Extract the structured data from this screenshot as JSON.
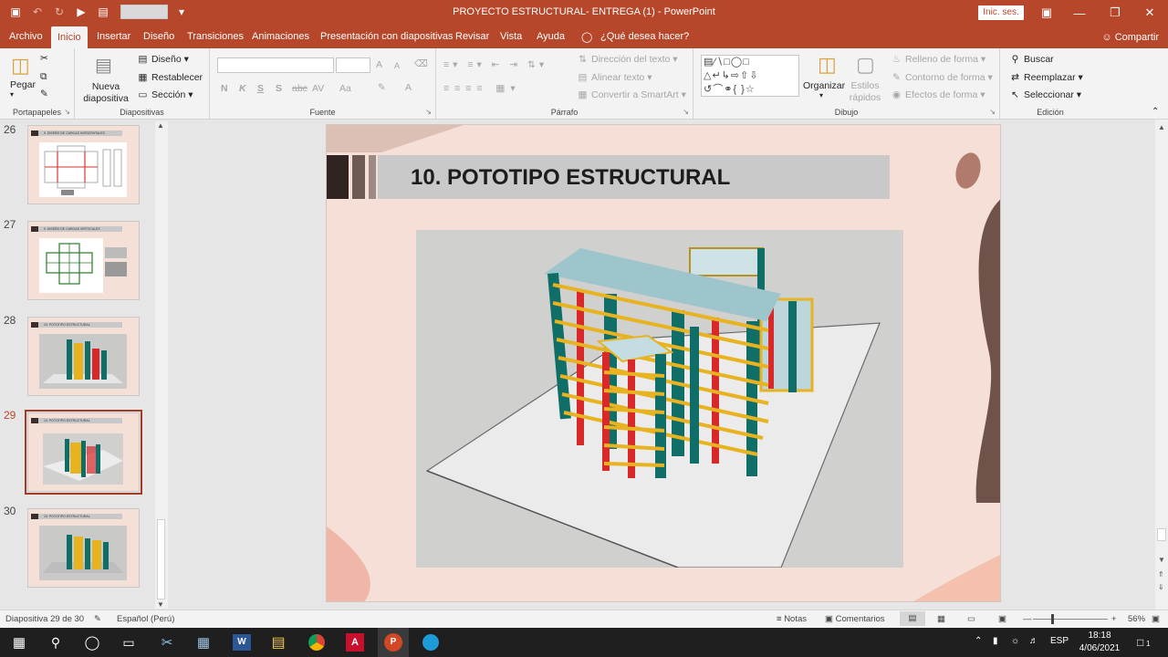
{
  "window": {
    "title": "PROYECTO ESTRUCTURAL- ENTREGA (1)  -  PowerPoint",
    "signin": "Inic. ses."
  },
  "tabs": [
    {
      "label": "Archivo"
    },
    {
      "label": "Inicio"
    },
    {
      "label": "Insertar"
    },
    {
      "label": "Diseño"
    },
    {
      "label": "Transiciones"
    },
    {
      "label": "Animaciones"
    },
    {
      "label": "Presentación con diapositivas"
    },
    {
      "label": "Revisar"
    },
    {
      "label": "Vista"
    },
    {
      "label": "Ayuda"
    }
  ],
  "tell_me": "¿Qué desea hacer?",
  "share": "Compartir",
  "ribbon": {
    "portapapeles": {
      "label": "Portapapeles",
      "paste": "Pegar"
    },
    "diapositivas": {
      "label": "Diapositivas",
      "new_slide": "Nueva diapositiva",
      "layout": "Diseño",
      "reset": "Restablecer",
      "section": "Sección"
    },
    "fuente": {
      "label": "Fuente",
      "bold": "N",
      "italic": "K",
      "underline": "S",
      "shadow": "S",
      "strike": "abc",
      "spacing": "AV",
      "case": "Aa",
      "grow": "A",
      "shrink": "A",
      "color": "A"
    },
    "parrafo": {
      "label": "Párrafo",
      "text_direction": "Dirección del texto",
      "align_text": "Alinear texto",
      "smartart": "Convertir a SmartArt"
    },
    "dibujo": {
      "label": "Dibujo",
      "arrange": "Organizar",
      "quick_styles": "Estilos rápidos",
      "fill": "Relleno de forma",
      "outline": "Contorno de forma",
      "effects": "Efectos de forma"
    },
    "edicion": {
      "label": "Edición",
      "find": "Buscar",
      "replace": "Reemplazar",
      "select": "Seleccionar"
    }
  },
  "thumbnails": [
    {
      "num": "26",
      "title": "9. DISEÑO DE CARGAS HORIZONTALES"
    },
    {
      "num": "27",
      "title": "9. DISEÑO DE CARGAS VERTICALES"
    },
    {
      "num": "28",
      "title": "10. POTOTIPO ESTRUCTURAL"
    },
    {
      "num": "29",
      "title": "10. POTOTIPO ESTRUCTURAL"
    },
    {
      "num": "30",
      "title": "10. POTOTIPO ESTRUCTURAL"
    }
  ],
  "slide": {
    "title": "10. POTOTIPO ESTRUCTURAL"
  },
  "status": {
    "slide_count": "Diapositiva 29 de 30",
    "language": "Español (Perú)",
    "notes": "Notas",
    "comments": "Comentarios",
    "zoom": "56%"
  },
  "taskbar": {
    "lang": "ESP",
    "time": "18:18",
    "date": "4/06/2021",
    "notifications": "1"
  },
  "colors": {
    "accent": "#b7472a",
    "column_teal": "#0f6e67",
    "beam_yellow": "#e8b320",
    "column_red": "#d8282a"
  }
}
